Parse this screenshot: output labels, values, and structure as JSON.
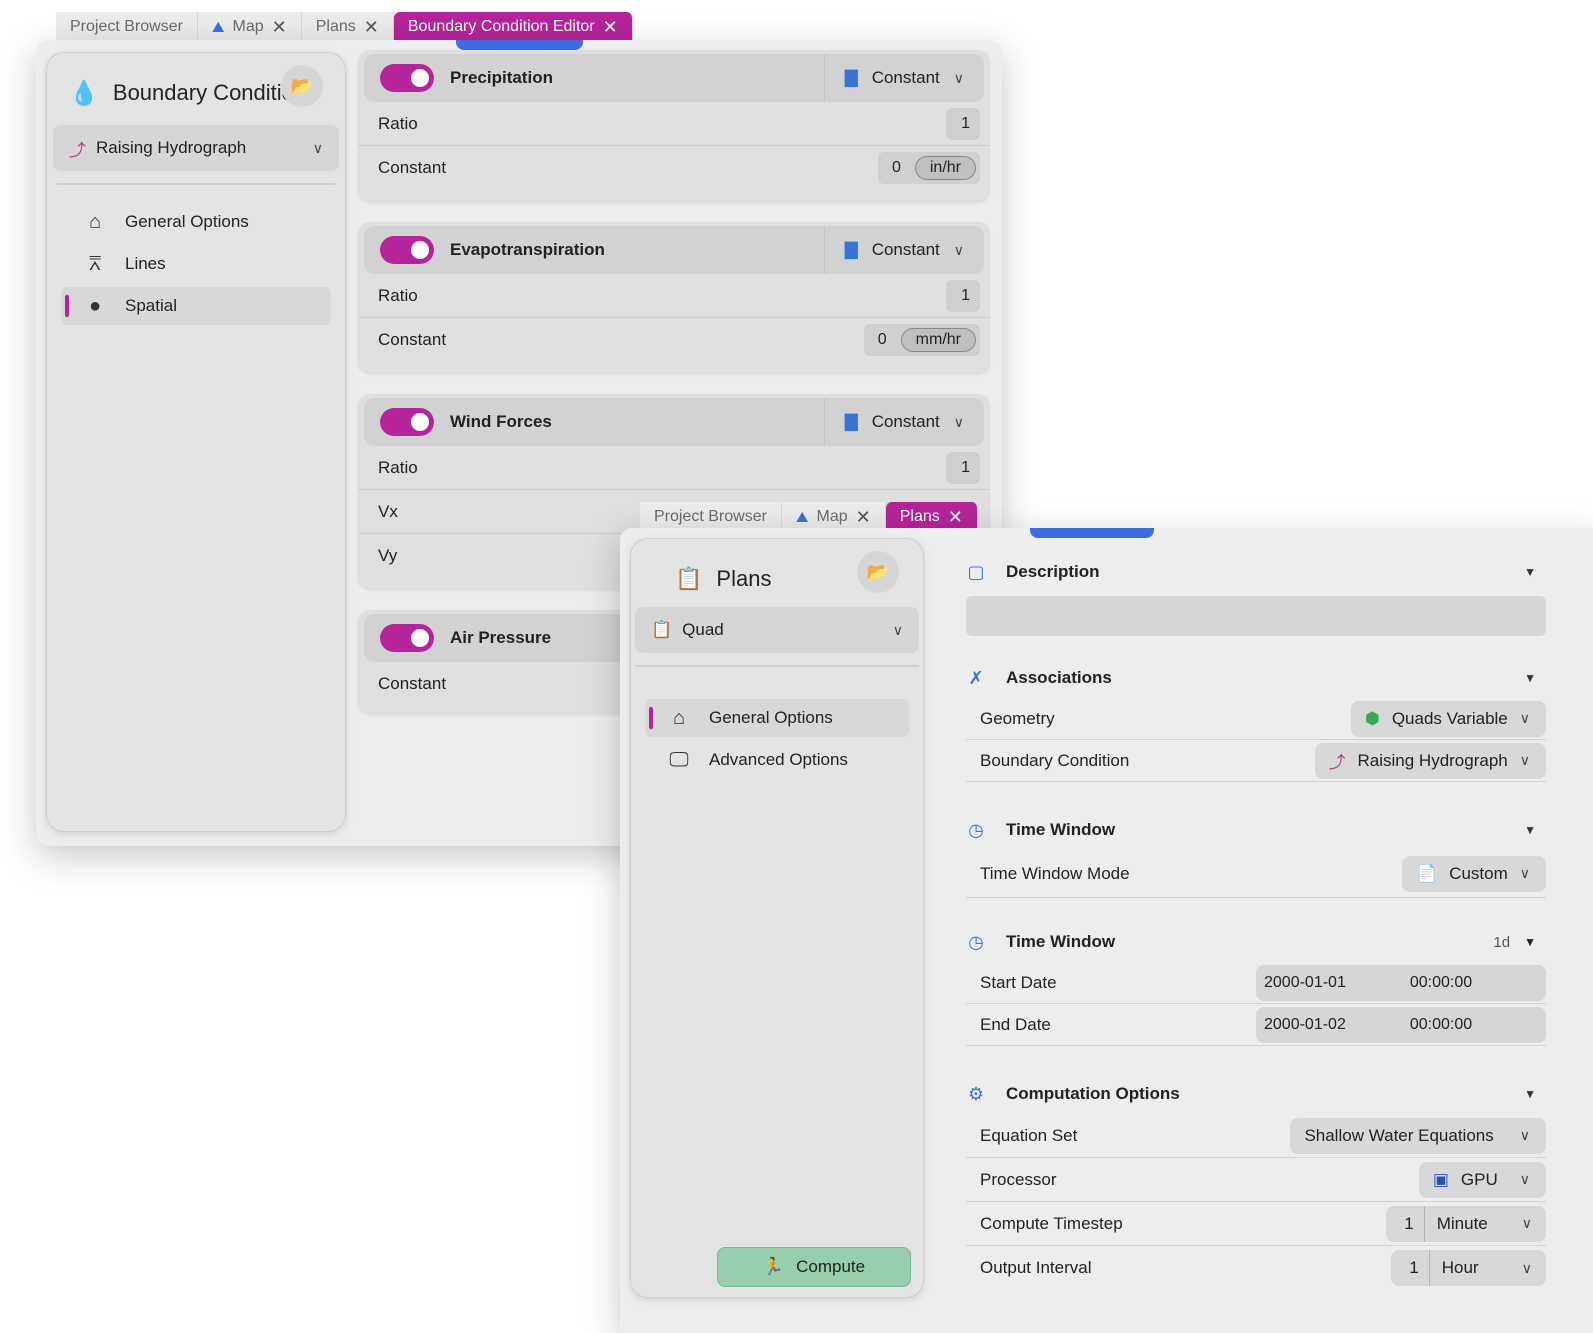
{
  "window1": {
    "tabs": [
      {
        "label": "Project Browser",
        "closable": false,
        "icon": null
      },
      {
        "label": "Map",
        "closable": true,
        "icon": "map-icon"
      },
      {
        "label": "Plans",
        "closable": true,
        "icon": null
      },
      {
        "label": "Boundary Condition Editor",
        "closable": true,
        "icon": null,
        "active": true
      }
    ],
    "sidebar": {
      "title": "Boundary Conditio",
      "title_icon": "droplet-icon",
      "selector_label": "Raising Hydrograph",
      "nav": [
        {
          "label": "General Options",
          "icon": "home-icon"
        },
        {
          "label": "Lines",
          "icon": "lines-icon"
        },
        {
          "label": "Spatial",
          "icon": "drops-icon",
          "active": true
        }
      ]
    },
    "panels": {
      "precipitation": {
        "title": "Precipitation",
        "mode": "Constant",
        "enabled": true,
        "ratio_label": "Ratio",
        "ratio_value": "1",
        "constant_label": "Constant",
        "constant_value": "0",
        "unit": "in/hr"
      },
      "evapotranspiration": {
        "title": "Evapotranspiration",
        "mode": "Constant",
        "enabled": true,
        "ratio_label": "Ratio",
        "ratio_value": "1",
        "constant_label": "Constant",
        "constant_value": "0",
        "unit": "mm/hr"
      },
      "wind": {
        "title": "Wind Forces",
        "mode": "Constant",
        "enabled": true,
        "ratio_label": "Ratio",
        "ratio_value": "1",
        "vx_label": "Vx",
        "vy_label": "Vy"
      },
      "air_pressure": {
        "title": "Air Pressure",
        "enabled": true,
        "constant_label": "Constant"
      }
    }
  },
  "window2": {
    "tabs": [
      {
        "label": "Project Browser",
        "closable": false
      },
      {
        "label": "Map",
        "closable": true,
        "icon": "map-icon"
      },
      {
        "label": "Plans",
        "closable": true,
        "active": true
      }
    ],
    "sidebar": {
      "title": "Plans",
      "selector_label": "Quad",
      "nav": [
        {
          "label": "General Options",
          "icon": "home-icon",
          "active": true
        },
        {
          "label": "Advanced Options",
          "icon": "monitor-icon"
        }
      ],
      "compute_label": "Compute"
    },
    "description": {
      "title": "Description",
      "value": ""
    },
    "associations": {
      "title": "Associations",
      "geometry_label": "Geometry",
      "geometry_value": "Quads Variable",
      "bc_label": "Boundary Condition",
      "bc_value": "Raising Hydrograph"
    },
    "time_window_mode": {
      "title": "Time Window",
      "mode_label": "Time Window Mode",
      "mode_value": "Custom"
    },
    "time_window": {
      "title": "Time Window",
      "duration": "1d",
      "start_label": "Start Date",
      "start_date": "2000-01-01",
      "start_time": "00:00:00",
      "end_label": "End Date",
      "end_date": "2000-01-02",
      "end_time": "00:00:00"
    },
    "computation": {
      "title": "Computation Options",
      "equation_label": "Equation Set",
      "equation_value": "Shallow Water Equations",
      "processor_label": "Processor",
      "processor_value": "GPU",
      "timestep_label": "Compute Timestep",
      "timestep_value": "1",
      "timestep_unit": "Minute",
      "output_label": "Output Interval",
      "output_value": "1",
      "output_unit": "Hour"
    }
  },
  "colors": {
    "accent": "#b5249a",
    "blue": "#3c6ce0",
    "compute": "#97cfae"
  }
}
